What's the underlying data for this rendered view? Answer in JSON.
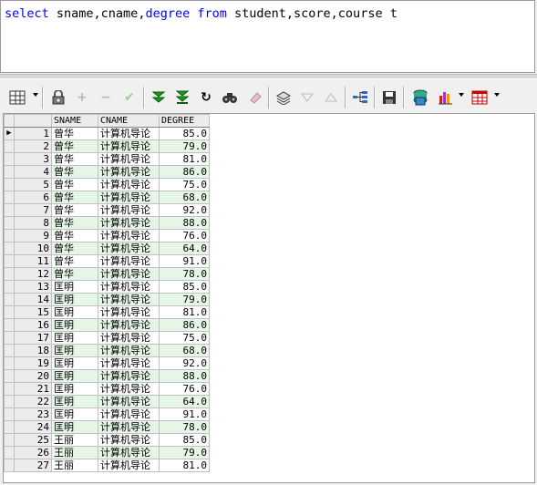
{
  "editor": {
    "sql": [
      {
        "t": "select",
        "kw": true
      },
      {
        "t": " sname,cname,",
        "kw": false
      },
      {
        "t": "degree",
        "kw": true
      },
      {
        "t": " ",
        "kw": false
      },
      {
        "t": "from",
        "kw": true
      },
      {
        "t": " student,score,course t",
        "kw": false
      }
    ]
  },
  "grid": {
    "columns": [
      "SNAME",
      "CNAME",
      "DEGREE"
    ],
    "current_row_marker": "▶",
    "rows": [
      [
        "1",
        "曾华",
        "计算机导论",
        "85.0"
      ],
      [
        "2",
        "曾华",
        "计算机导论",
        "79.0"
      ],
      [
        "3",
        "曾华",
        "计算机导论",
        "81.0"
      ],
      [
        "4",
        "曾华",
        "计算机导论",
        "86.0"
      ],
      [
        "5",
        "曾华",
        "计算机导论",
        "75.0"
      ],
      [
        "6",
        "曾华",
        "计算机导论",
        "68.0"
      ],
      [
        "7",
        "曾华",
        "计算机导论",
        "92.0"
      ],
      [
        "8",
        "曾华",
        "计算机导论",
        "88.0"
      ],
      [
        "9",
        "曾华",
        "计算机导论",
        "76.0"
      ],
      [
        "10",
        "曾华",
        "计算机导论",
        "64.0"
      ],
      [
        "11",
        "曾华",
        "计算机导论",
        "91.0"
      ],
      [
        "12",
        "曾华",
        "计算机导论",
        "78.0"
      ],
      [
        "13",
        "匡明",
        "计算机导论",
        "85.0"
      ],
      [
        "14",
        "匡明",
        "计算机导论",
        "79.0"
      ],
      [
        "15",
        "匡明",
        "计算机导论",
        "81.0"
      ],
      [
        "16",
        "匡明",
        "计算机导论",
        "86.0"
      ],
      [
        "17",
        "匡明",
        "计算机导论",
        "75.0"
      ],
      [
        "18",
        "匡明",
        "计算机导论",
        "68.0"
      ],
      [
        "19",
        "匡明",
        "计算机导论",
        "92.0"
      ],
      [
        "20",
        "匡明",
        "计算机导论",
        "88.0"
      ],
      [
        "21",
        "匡明",
        "计算机导论",
        "76.0"
      ],
      [
        "22",
        "匡明",
        "计算机导论",
        "64.0"
      ],
      [
        "23",
        "匡明",
        "计算机导论",
        "91.0"
      ],
      [
        "24",
        "匡明",
        "计算机导论",
        "78.0"
      ],
      [
        "25",
        "王丽",
        "计算机导论",
        "85.0"
      ],
      [
        "26",
        "王丽",
        "计算机导论",
        "79.0"
      ],
      [
        "27",
        "王丽",
        "计算机导论",
        "81.0"
      ]
    ]
  },
  "toolbar": {
    "icons": [
      "grid-icon",
      "lock-icon",
      "add-row-icon",
      "delete-row-icon",
      "post-changes-icon",
      "next-page-icon",
      "last-page-icon",
      "refresh-icon",
      "find-icon",
      "clear-icon",
      "query-by-example-icon",
      "sort-descending-icon",
      "sort-ascending-icon",
      "explain-plan-icon",
      "save-icon",
      "export-icon",
      "chart-icon",
      "table-options-icon"
    ]
  },
  "colors": {
    "keyword": "#0000ff",
    "alt_row": "#e6f6e6",
    "header_bg": "#ececec"
  }
}
